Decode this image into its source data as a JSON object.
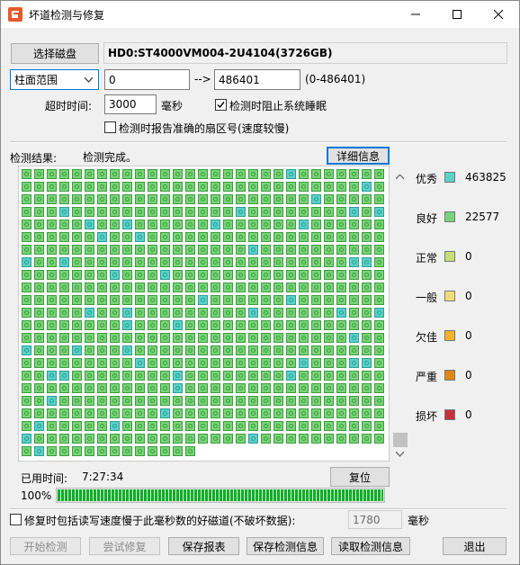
{
  "window": {
    "title": "坏道检测与修复"
  },
  "toolbar": {
    "select_disk_label": "选择磁盘",
    "disk_name": "HD0:ST4000VM004-2U4104(3726GB)"
  },
  "range": {
    "mode": "柱面范围",
    "start": "0",
    "arrow": "-->",
    "end": "486401",
    "hint": "(0-486401)"
  },
  "timeout": {
    "label": "超时时间:",
    "value": "3000",
    "unit": "毫秒"
  },
  "options": {
    "prevent_sleep": {
      "label": "检测时阻止系统睡眠",
      "checked": true
    },
    "report_sector": {
      "label": "检测时报告准确的扇区号(速度较慢)",
      "checked": false
    }
  },
  "result": {
    "label": "检测结果:",
    "status": "检测完成。",
    "details_button": "详细信息"
  },
  "legend": [
    {
      "label": "优秀",
      "count": "463825",
      "color": "#5ad2c6"
    },
    {
      "label": "良好",
      "count": "22577",
      "color": "#78d478"
    },
    {
      "label": "正常",
      "count": "0",
      "color": "#c8de78"
    },
    {
      "label": "一般",
      "count": "0",
      "color": "#f2dc78"
    },
    {
      "label": "欠佳",
      "count": "0",
      "color": "#f5b229"
    },
    {
      "label": "严重",
      "count": "0",
      "color": "#e08a14"
    },
    {
      "label": "损坏",
      "count": "0",
      "color": "#c8303a"
    }
  ],
  "elapsed": {
    "label": "已用时间:",
    "value": "7:27:34",
    "reset_button": "复位"
  },
  "progress": {
    "percent_label": "100%",
    "value": 1.0
  },
  "repair": {
    "label": "修复时包括读写速度慢于此毫秒数的好磁道(不破坏数据):",
    "checked": false,
    "value": "1780",
    "unit": "毫秒"
  },
  "buttons": {
    "start": "开始检测",
    "try_repair": "尝试修复",
    "save_report": "保存报表",
    "save_info": "保存检测信息",
    "load_info": "读取检测信息",
    "exit": "退出"
  }
}
